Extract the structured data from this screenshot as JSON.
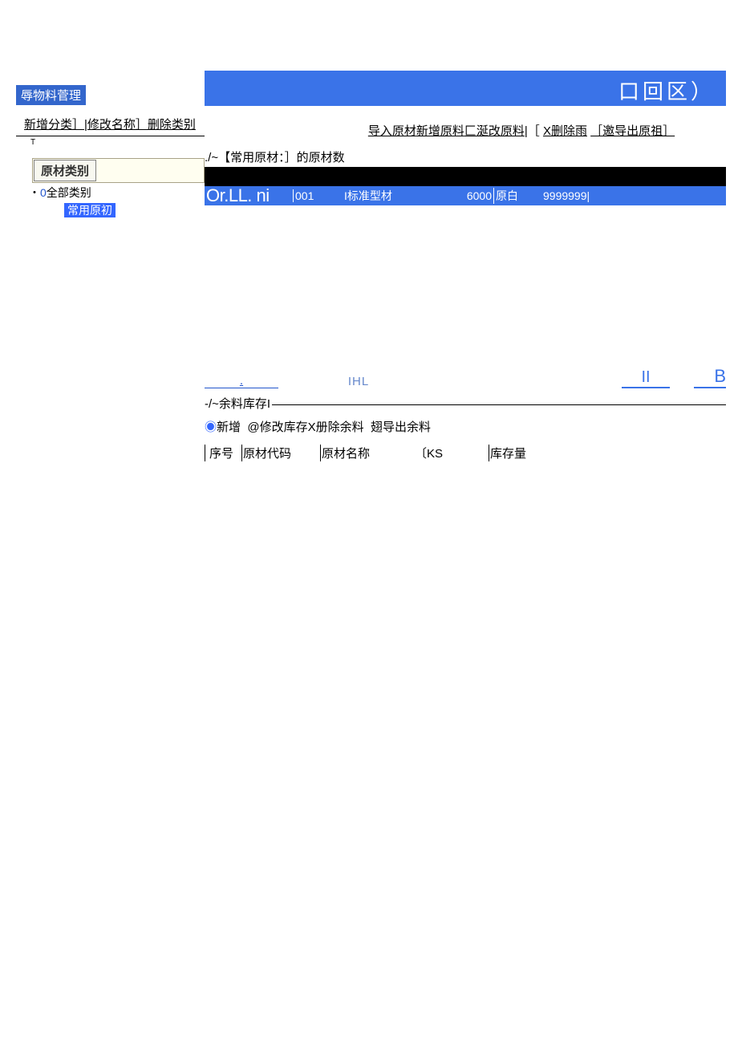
{
  "window": {
    "title_tag": "辱物料菅理",
    "controls_text": "口回区）"
  },
  "sidebar": {
    "actions": "新增分类］|修改名称］删除类别",
    "t_mark": "T",
    "category_header": "原材类别",
    "tree": {
      "bullet": "・",
      "num": "0",
      "label": "全部类别",
      "sub": "常用原初"
    }
  },
  "main": {
    "top_actions": {
      "a1": "导入原材",
      "a2": "新增原料",
      "a3": "匚涎改原料",
      "sep": "|［",
      "a4": "X删除雨",
      "a5": "［邀导出原祖］"
    },
    "section_title": "./~【常用原材：］的原材数",
    "row": {
      "orll": "Or.LL. ni",
      "code": "001",
      "name": "I标准型材",
      "len": "6000",
      "color": "原白",
      "qty": "9999999"
    },
    "mid": {
      "dot": ".",
      "ihl": "IHL",
      "ii": "II",
      "b": "B"
    },
    "stock": {
      "title": "-/~余料库存I",
      "actions": {
        "bullet": "◉",
        "a1": "新增",
        "a2": "@修改库存",
        "a3": "X册除余料",
        "a4": "翅导出余料"
      },
      "cols": {
        "c1": "序号",
        "c2": "原材代码",
        "c3": "原材名称",
        "c4": "〔KS",
        "c5": "库存量"
      }
    }
  }
}
